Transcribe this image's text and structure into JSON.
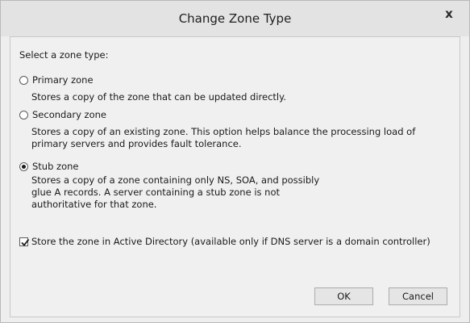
{
  "dialog": {
    "title": "Change Zone Type",
    "close_glyph": "x",
    "prompt": "Select a zone type:"
  },
  "options": [
    {
      "label": "Primary zone",
      "selected": false,
      "description": [
        "Stores a copy of the zone that can be updated directly."
      ]
    },
    {
      "label": "Secondary zone",
      "selected": false,
      "description": [
        "Stores a copy of an existing zone. This option helps balance the processing load of",
        "primary servers and provides fault tolerance."
      ]
    },
    {
      "label": "Stub zone",
      "selected": true,
      "description": [
        "Stores a copy of a zone containing only NS, SOA, and possibly",
        "glue A records. A server containing a stub zone is not",
        "authoritative for that zone."
      ]
    }
  ],
  "store_in_ad": {
    "label": "Store the zone in Active Directory (available only if DNS server is a domain controller)",
    "checked": true
  },
  "buttons": {
    "ok": "OK",
    "cancel": "Cancel"
  },
  "icons": {
    "close": "close-icon",
    "check": "checkmark-icon"
  }
}
